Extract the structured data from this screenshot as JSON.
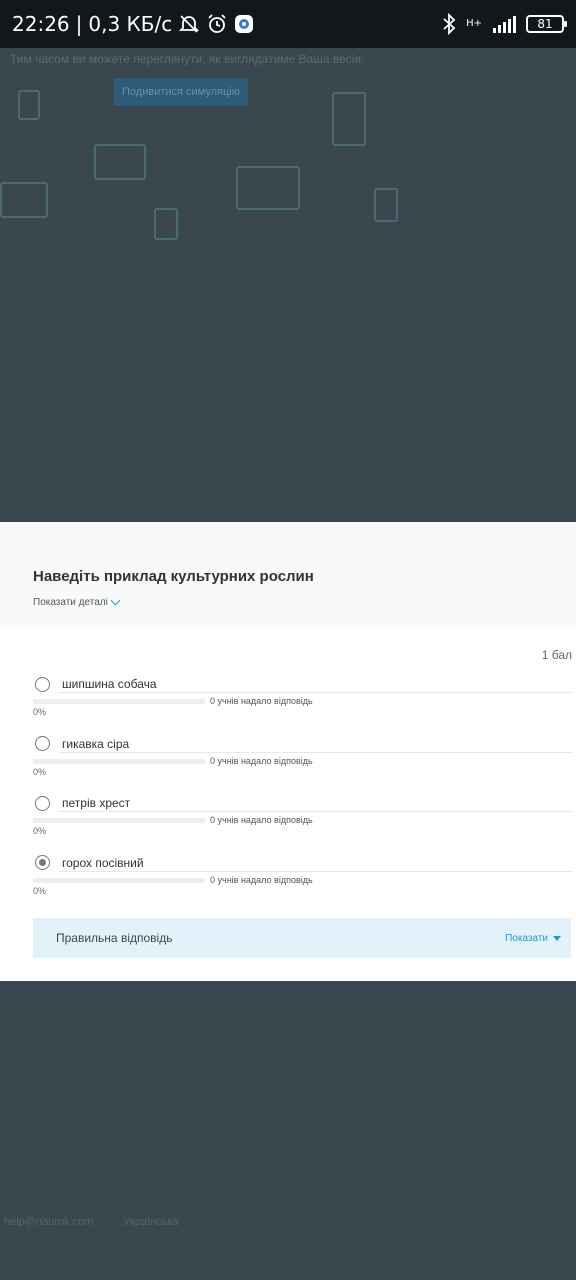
{
  "status_bar": {
    "time": "22:26",
    "separator": "|",
    "speed": "0,3 КБ/с",
    "network": "H+",
    "battery": "81"
  },
  "background": {
    "hint": "Тим часом ви можете переглянути, як виглядатиме Ваша весія.",
    "button": "Подивитися симуляцію",
    "footer_email": "help@naurok.com",
    "footer_language": "Українська"
  },
  "modal": {
    "question": "Наведіть приклад культурних рослин",
    "details_toggle": "Показати деталі",
    "score": "1 бал",
    "options": [
      {
        "label": "шипшина собача",
        "count": "0 учнів надало відповідь",
        "percent": "0%",
        "fraction": 0,
        "selected": false
      },
      {
        "label": "гикавка сіра",
        "count": "0 учнів надало відповідь",
        "percent": "0%",
        "fraction": 0,
        "selected": false
      },
      {
        "label": "петрів хрест",
        "count": "0 учнів надало відповідь",
        "percent": "0%",
        "fraction": 0,
        "selected": false
      },
      {
        "label": "горох посівний",
        "count": "0 учнів надало відповідь",
        "percent": "0%",
        "fraction": 0,
        "selected": true
      }
    ],
    "correct_answer": {
      "label": "Правильна відповідь",
      "show": "Показати"
    }
  },
  "colors": {
    "accent": "#1a9fc7",
    "overlay": "#3b474e",
    "answer_bg": "#e3f2fa"
  }
}
